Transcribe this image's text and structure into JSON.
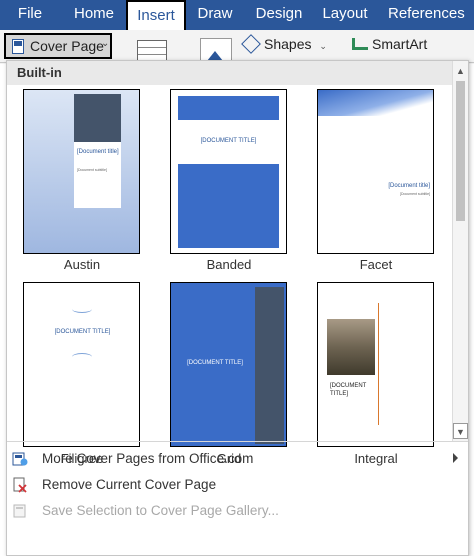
{
  "ribbon": {
    "tabs": [
      {
        "label": "File"
      },
      {
        "label": "Home"
      },
      {
        "label": "Insert",
        "active": true
      },
      {
        "label": "Draw"
      },
      {
        "label": "Design"
      },
      {
        "label": "Layout"
      },
      {
        "label": "References"
      }
    ],
    "cover_page_label": "Cover Page",
    "shapes_label": "Shapes",
    "smartart_label": "SmartArt"
  },
  "gallery": {
    "section_title": "Built-in",
    "templates": [
      {
        "name": "Austin",
        "title": "[Document title]",
        "subtitle": "[Document subtitle]"
      },
      {
        "name": "Banded",
        "title": "[DOCUMENT TITLE]"
      },
      {
        "name": "Facet",
        "title": "[Document title]",
        "subtitle": "[Document subtitle]"
      },
      {
        "name": "Filigree",
        "title": "[DOCUMENT TITLE]"
      },
      {
        "name": "Grid",
        "title": "[DOCUMENT TITLE]"
      },
      {
        "name": "Integral",
        "title": "[DOCUMENT TITLE]"
      }
    ]
  },
  "menu": {
    "more_label": "More Cover Pages from Office.com",
    "remove_label": "Remove Current Cover Page",
    "save_label": "Save Selection to Cover Page Gallery..."
  },
  "colors": {
    "ribbon_blue": "#2b579a",
    "template_blue": "#3a6cc7",
    "grid_slate": "#44546a"
  }
}
